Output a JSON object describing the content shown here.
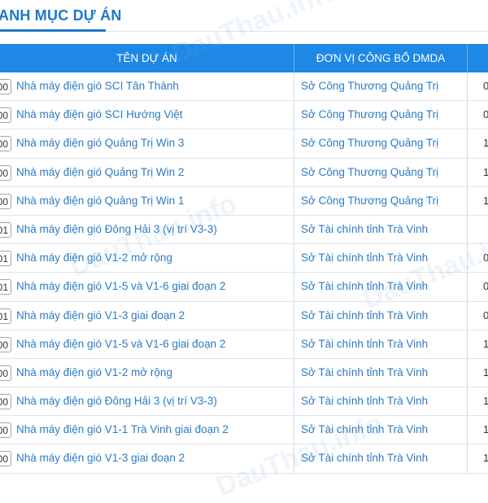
{
  "section": {
    "title": "ANH MỤC DỰ ÁN"
  },
  "table": {
    "headers": [
      "TÊN DỰ ÁN",
      "ĐƠN VỊ CÔNG BỐ DMDA",
      ""
    ],
    "rows": [
      {
        "code": "00",
        "name": "Nhà máy điện gió SCI Tân Thành",
        "unit": "Sở Công Thương Quảng Trị",
        "extra": "0"
      },
      {
        "code": "00",
        "name": "Nhà máy điện gió SCI Hướng Việt",
        "unit": "Sở Công Thương Quảng Trị",
        "extra": "0"
      },
      {
        "code": "00",
        "name": "Nhà máy điện gió Quảng Trị Win 3",
        "unit": "Sở Công Thương Quảng Trị",
        "extra": "1"
      },
      {
        "code": "00",
        "name": "Nhà máy điện gió Quảng Trị Win 2",
        "unit": "Sở Công Thương Quảng Trị",
        "extra": "1"
      },
      {
        "code": "00",
        "name": "Nhà máy điện gió Quảng Trị Win 1",
        "unit": "Sở Công Thương Quảng Trị",
        "extra": "1"
      },
      {
        "code": "01",
        "name": "Nhà máy điện gió Đông Hải 3 (vị trí V3-3)",
        "unit": "Sở Tài chính tỉnh Trà Vinh",
        "extra": ""
      },
      {
        "code": "01",
        "name": "Nhà máy điện gió V1-2 mở rộng",
        "unit": "Sở Tài chính tỉnh Trà Vinh",
        "extra": "0"
      },
      {
        "code": "01",
        "name": "Nhà máy điện gió V1-5 và V1-6 giai đoạn 2",
        "unit": "Sở Tài chính tỉnh Trà Vinh",
        "extra": "0"
      },
      {
        "code": "01",
        "name": "Nhà máy điện gió V1-3 giai đoạn 2",
        "unit": "Sở Tài chính tỉnh Trà Vinh",
        "extra": "0"
      },
      {
        "code": "00",
        "name": "Nhà máy điện gió V1-5 và V1-6 giai đoạn 2",
        "unit": "Sở Tài chính tỉnh Trà Vinh",
        "extra": "1"
      },
      {
        "code": "00",
        "name": "Nhà máy điện gió V1-2 mở rộng",
        "unit": "Sở Tài chính tỉnh Trà Vinh",
        "extra": "1"
      },
      {
        "code": "00",
        "name": "Nhà máy điện gió Đông Hải 3 (vị trí V3-3)",
        "unit": "Sở Tài chính tỉnh Trà Vinh",
        "extra": "1"
      },
      {
        "code": "00",
        "name": "Nhà máy điện gió V1-1 Trà Vinh giai đoạn 2",
        "unit": "Sở Tài chính tỉnh Trà Vinh",
        "extra": "1"
      },
      {
        "code": "00",
        "name": "Nhà máy điện gió V1-3 giai đoạn 2",
        "unit": "Sở Tài chính tỉnh Trà Vinh",
        "extra": "1"
      }
    ]
  },
  "watermark": "DauThau.info",
  "colors": {
    "accent": "#1f78c8",
    "header_bg": "#1e88e5",
    "link": "#2c7bc4"
  }
}
